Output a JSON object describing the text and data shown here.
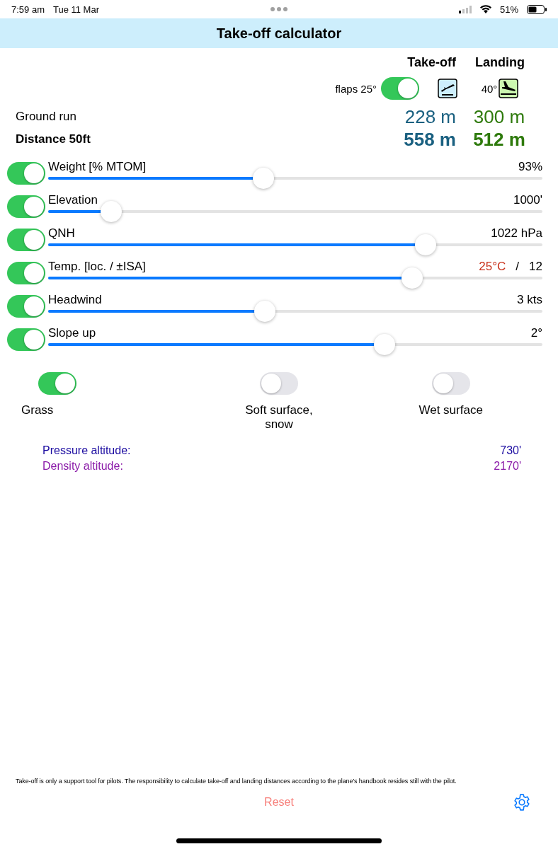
{
  "status_bar": {
    "time": "7:59 am",
    "date": "Tue 11 Mar",
    "battery": "51%"
  },
  "title": "Take-off calculator",
  "columns": [
    {
      "label": "Take-off",
      "kind": "takeoff"
    },
    {
      "label": "Landing",
      "kind": "landing"
    }
  ],
  "flaps": {
    "takeoff_label": "flaps 25°",
    "takeoff_on": true,
    "landing_label": "40°"
  },
  "results": [
    {
      "label": "Ground run",
      "bold": false,
      "takeoff": "228 m",
      "landing": "300 m"
    },
    {
      "label": "Distance 50ft",
      "bold": true,
      "takeoff": "558 m",
      "landing": "512 m"
    }
  ],
  "sliders": [
    {
      "label": "Weight [% MTOM]",
      "on": true,
      "level": 0.436,
      "reading": "93%"
    },
    {
      "label": "Elevation",
      "on": true,
      "level": 0.127,
      "reading": "1000'"
    },
    {
      "label": "QNH",
      "on": true,
      "level": 0.763,
      "reading": "1022 hPa"
    },
    {
      "label": "Temp. [loc. / ±ISA]",
      "on": true,
      "level": 0.737,
      "reading": "12",
      "local_reading": "25°C",
      "separator": "/"
    },
    {
      "label": "Headwind",
      "on": true,
      "level": 0.439,
      "reading": "3 kts"
    },
    {
      "label": "Slope up",
      "on": true,
      "level": 0.681,
      "reading": "2°"
    }
  ],
  "surfaces": [
    {
      "label": "Grass",
      "on": true
    },
    {
      "label": "Soft surface,\nsnow",
      "on": false
    },
    {
      "label": "Wet surface",
      "on": false
    }
  ],
  "altitudes": [
    {
      "label": "Pressure altitude:",
      "value": "730'",
      "color": "#1a0aa0"
    },
    {
      "label": "Density altitude:",
      "value": "2170'",
      "color": "#8a1aa8"
    }
  ],
  "disclaimer": "Take-off is only a support tool for pilots. The responsibility to calculate take-off and landing distances according to the plane's handbook resides still with the pilot.",
  "reset_label": "Reset"
}
